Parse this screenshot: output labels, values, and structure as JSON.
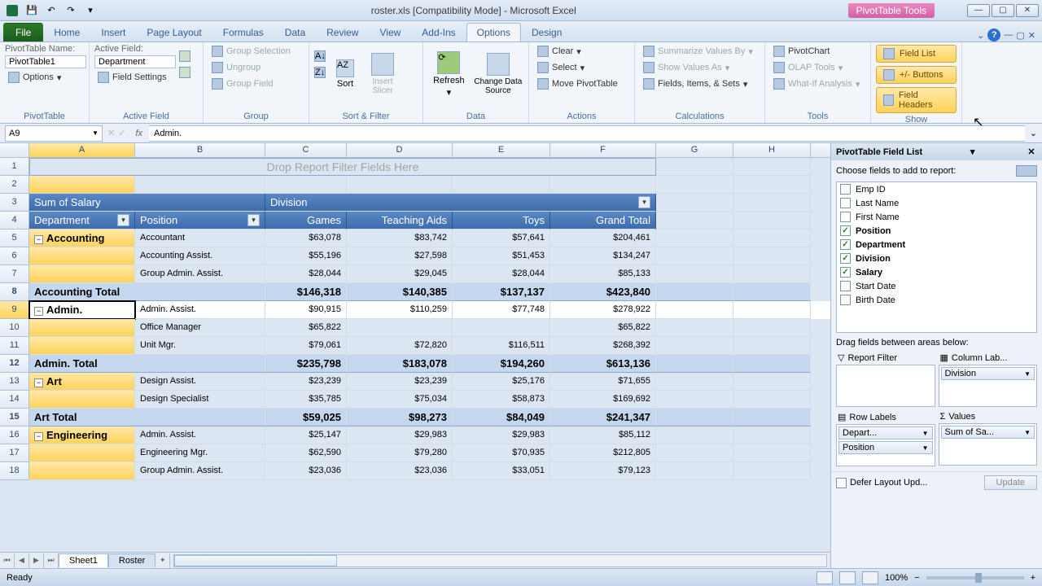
{
  "window": {
    "title": "roster.xls  [Compatibility Mode] - Microsoft Excel",
    "contextual_tab": "PivotTable Tools"
  },
  "tabs": {
    "file": "File",
    "items": [
      "Home",
      "Insert",
      "Page Layout",
      "Formulas",
      "Data",
      "Review",
      "View",
      "Add-Ins"
    ],
    "ctx": [
      "Options",
      "Design"
    ],
    "active": "Options"
  },
  "ribbon": {
    "pivottable": {
      "group": "PivotTable",
      "name_label": "PivotTable Name:",
      "name_value": "PivotTable1",
      "options": "Options"
    },
    "activefield": {
      "group": "Active Field",
      "label": "Active Field:",
      "value": "Department",
      "settings": "Field Settings"
    },
    "group": {
      "group": "Group",
      "selection": "Group Selection",
      "ungroup": "Ungroup",
      "field": "Group Field"
    },
    "sortfilter": {
      "group": "Sort & Filter",
      "sort": "Sort",
      "slicer": "Insert Slicer"
    },
    "data": {
      "group": "Data",
      "refresh": "Refresh",
      "change": "Change Data Source"
    },
    "actions": {
      "group": "Actions",
      "clear": "Clear",
      "select": "Select",
      "move": "Move PivotTable"
    },
    "calc": {
      "group": "Calculations",
      "summarize": "Summarize Values By",
      "showas": "Show Values As",
      "fields": "Fields, Items, & Sets"
    },
    "tools": {
      "group": "Tools",
      "chart": "PivotChart",
      "olap": "OLAP Tools",
      "whatif": "What-If Analysis"
    },
    "show": {
      "group": "Show",
      "fieldlist": "Field List",
      "buttons": "+/- Buttons",
      "headers": "Field Headers"
    }
  },
  "formulabar": {
    "namebox": "A9",
    "value": "Admin."
  },
  "pivot": {
    "drop_filter": "Drop Report Filter Fields Here",
    "sum_label": "Sum of Salary",
    "col_field": "Division",
    "row_fields": [
      "Department",
      "Position"
    ],
    "cols": [
      "Games",
      "Teaching Aids",
      "Toys",
      "Grand Total"
    ],
    "rows": [
      {
        "type": "group",
        "dept": "Accounting"
      },
      {
        "pos": "Accountant",
        "v": [
          "$63,078",
          "$83,742",
          "$57,641",
          "$204,461"
        ]
      },
      {
        "pos": "Accounting Assist.",
        "v": [
          "$55,196",
          "$27,598",
          "$51,453",
          "$134,247"
        ]
      },
      {
        "pos": "Group Admin. Assist.",
        "v": [
          "$28,044",
          "$29,045",
          "$28,044",
          "$85,133"
        ]
      },
      {
        "type": "total",
        "label": "Accounting Total",
        "v": [
          "$146,318",
          "$140,385",
          "$137,137",
          "$423,840"
        ]
      },
      {
        "type": "group",
        "dept": "Admin."
      },
      {
        "pos": "Admin. Assist.",
        "v": [
          "$90,915",
          "$110,259",
          "$77,748",
          "$278,922"
        ]
      },
      {
        "pos": "Office Manager",
        "v": [
          "$65,822",
          "",
          "",
          "$65,822"
        ]
      },
      {
        "pos": "Unit Mgr.",
        "v": [
          "$79,061",
          "$72,820",
          "$116,511",
          "$268,392"
        ]
      },
      {
        "type": "total",
        "label": "Admin. Total",
        "v": [
          "$235,798",
          "$183,078",
          "$194,260",
          "$613,136"
        ]
      },
      {
        "type": "group",
        "dept": "Art"
      },
      {
        "pos": "Design Assist.",
        "v": [
          "$23,239",
          "$23,239",
          "$25,176",
          "$71,655"
        ]
      },
      {
        "pos": "Design Specialist",
        "v": [
          "$35,785",
          "$75,034",
          "$58,873",
          "$169,692"
        ]
      },
      {
        "type": "total",
        "label": "Art Total",
        "v": [
          "$59,025",
          "$98,273",
          "$84,049",
          "$241,347"
        ]
      },
      {
        "type": "group",
        "dept": "Engineering"
      },
      {
        "pos": "Admin. Assist.",
        "v": [
          "$25,147",
          "$29,983",
          "$29,983",
          "$85,112"
        ]
      },
      {
        "pos": "Engineering Mgr.",
        "v": [
          "$62,590",
          "$79,280",
          "$70,935",
          "$212,805"
        ]
      },
      {
        "pos": "Group Admin. Assist.",
        "v": [
          "$23,036",
          "$23,036",
          "$33,051",
          "$79,123"
        ]
      }
    ]
  },
  "fieldlist": {
    "title": "PivotTable Field List",
    "hint": "Choose fields to add to report:",
    "fields": [
      {
        "name": "Emp ID",
        "checked": false
      },
      {
        "name": "Last Name",
        "checked": false
      },
      {
        "name": "First Name",
        "checked": false
      },
      {
        "name": "Position",
        "checked": true
      },
      {
        "name": "Department",
        "checked": true
      },
      {
        "name": "Division",
        "checked": true
      },
      {
        "name": "Salary",
        "checked": true
      },
      {
        "name": "Start Date",
        "checked": false
      },
      {
        "name": "Birth Date",
        "checked": false
      }
    ],
    "drag_hint": "Drag fields between areas below:",
    "areas": {
      "report_filter": "Report Filter",
      "column_labels": "Column Lab...",
      "row_labels": "Row Labels",
      "values": "Values"
    },
    "chips": {
      "column": [
        "Division"
      ],
      "rows": [
        "Depart...",
        "Position"
      ],
      "values": [
        "Sum of Sa..."
      ]
    },
    "defer": "Defer Layout Upd...",
    "update": "Update"
  },
  "sheets": {
    "active": "Sheet1",
    "other": "Roster"
  },
  "status": {
    "ready": "Ready",
    "zoom": "100%"
  },
  "cols": [
    "A",
    "B",
    "C",
    "D",
    "E",
    "F",
    "G",
    "H"
  ]
}
